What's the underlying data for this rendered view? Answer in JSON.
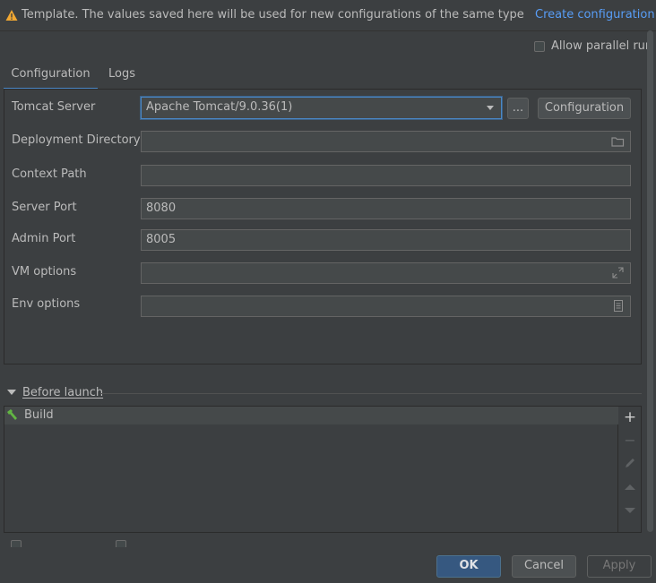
{
  "banner": {
    "text": "Template. The values saved here will be used for new configurations of the same type",
    "create_link": "Create configuration"
  },
  "allow_parallel": {
    "label": "Allow parallel run",
    "checked": false
  },
  "tabs": [
    {
      "label": "Configuration",
      "active": true
    },
    {
      "label": "Logs",
      "active": false
    }
  ],
  "form": {
    "tomcat_server": {
      "label": "Tomcat Server",
      "value": "Apache Tomcat/9.0.36(1)",
      "browse": "...",
      "config_button": "Configuration"
    },
    "deployment_directory": {
      "label": "Deployment Directory",
      "value": ""
    },
    "context_path": {
      "label": "Context Path",
      "value": ""
    },
    "server_port": {
      "label": "Server Port",
      "value": "8080"
    },
    "admin_port": {
      "label": "Admin Port",
      "value": "8005"
    },
    "vm_options": {
      "label": "VM options",
      "value": ""
    },
    "env_options": {
      "label": "Env options",
      "value": ""
    }
  },
  "before_launch": {
    "title": "Before launch",
    "items": [
      {
        "label": "Build",
        "icon": "hammer-icon"
      }
    ]
  },
  "buttons": {
    "ok": "OK",
    "cancel": "Cancel",
    "apply": "Apply"
  },
  "colors": {
    "accent": "#4a88c7",
    "link": "#589df6",
    "ok_bg": "#365880",
    "warning": "#f0a732"
  }
}
